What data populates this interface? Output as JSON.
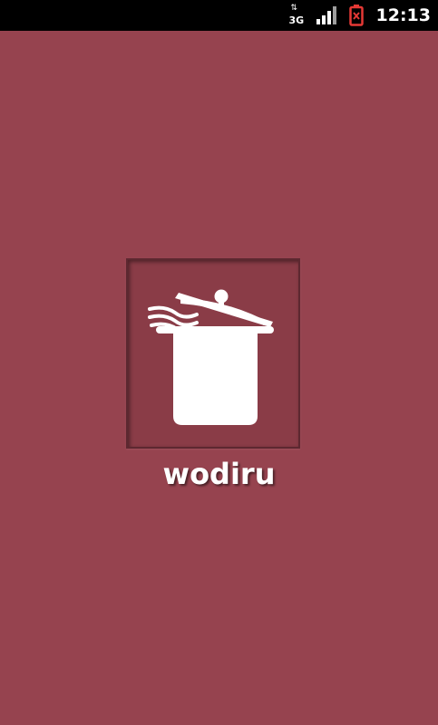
{
  "status_bar": {
    "network_type": "3G",
    "time": "12:13"
  },
  "splash": {
    "app_name": "wodiru",
    "logo_icon": "cooking-pot-icon"
  },
  "colors": {
    "background": "#96434f",
    "logo_frame": "#8a3c47",
    "status_bar": "#000000",
    "battery_warning": "#e53935",
    "icon_white": "#ffffff"
  }
}
